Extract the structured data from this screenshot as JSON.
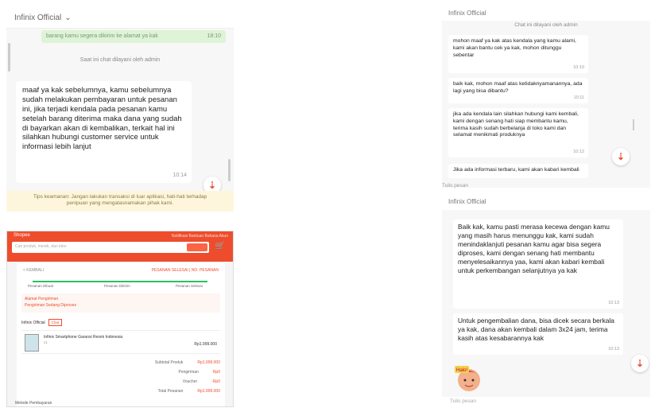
{
  "chat_left": {
    "header_title": "Infinix Official",
    "header_chevron": "⌄",
    "prev_message_snippet": "barang kamu segera dikirim ke alamat ya kak",
    "prev_message_time": "18:10",
    "system_message": "Saat ini chat dilayani oleh admin",
    "message_text": "maaf ya kak sebelumnya, kamu sebelumnya sudah melakukan pembayaran untuk pesanan ini, jika terjadi kendala pada pesanan kamu setelah barang diterima maka dana yang sudah di bayarkan akan di kembalikan, terkait hal ini silahkan hubungi customer service untuk informasi lebih lanjut",
    "message_time": "10:14",
    "warning_text": "Tips keamanan: Jangan lakukan transaksi di luar aplikasi, hati-hati terhadap penipuan yang mengatasnamakan pihak kami.",
    "down_icon": "⇣"
  },
  "order_page": {
    "brand": "Shopee",
    "top_links": "Notifikasi  Bantuan  Bahasa  Akun",
    "search_placeholder": "Cari produk, merek, dan toko",
    "cart_icon": "🛒",
    "back_label": "< KEMBALI",
    "order_status": "PESANAN SELESAI  |  NO. PESANAN",
    "progress_percent": 100,
    "steps": [
      "Pesanan Dibuat",
      "Pesanan Dikirim",
      "Pesanan Selesai"
    ],
    "address_label": "Alamat Pengiriman",
    "address_text": "Pengiriman Sedang Diproses",
    "shop_name": "Infinix Official",
    "chat_button": "Chat",
    "product_name": "Infinix Smartphone Garansi Resmi Indonesia",
    "product_qty": "x1",
    "product_price": "Rp1.999.000",
    "summary": [
      {
        "label": "Subtotal Produk",
        "value": "Rp1.999.000"
      },
      {
        "label": "Pengiriman",
        "value": "Rp0"
      },
      {
        "label": "Voucher",
        "value": "-Rp0"
      },
      {
        "label": "Total Pesanan",
        "value": "Rp1.999.000"
      }
    ],
    "footer_text": "Metode Pembayaran"
  },
  "chat_top_right": {
    "header_title": "Infinix Official",
    "system_message": "Chat ini dilayani oleh admin",
    "messages": [
      {
        "text": "mohon maaf ya kak atas kendala yang kamu alami, kami akan bantu cek ya kak, mohon ditunggu sebentar",
        "time": "10:10"
      },
      {
        "text": "baik kak, mohon maaf atas ketidaknyamanannya, ada lagi yang bisa dibantu?",
        "time": "10:11"
      },
      {
        "text": "jika ada kendala lain silahkan hubungi kami kembali, kami dengan senang hati siap membantu kamu, terima kasih sudah berbelanja di toko kami dan selamat menikmati produknya",
        "time": "10:12"
      },
      {
        "text": "Jika ada informasi terbaru, kami akan kabari kembali",
        "time": ""
      }
    ],
    "down_icon": "⇣"
  },
  "between_label": "Tulis pesan",
  "chat_bottom_right": {
    "header_title": "Infinix Official",
    "messages": [
      {
        "text": "Baik kak, kamu pasti merasa kecewa dengan kamu yang masih harus menunggu kak, kami sudah menindaklanjuti pesanan kamu agar bisa segera diproses, kami dengan senang hati membantu menyelesaikannya yaa, kami akan kabari kembali untuk perkembangan selanjutnya ya kak",
        "time": "10:13"
      },
      {
        "text": "Untuk pengembalian dana, bisa dicek secara berkala ya kak, dana akan kembali dalam 3x24 jam, terima kasih atas kesabarannya kak",
        "time": "10:13"
      }
    ],
    "sticker_label": "Halo!",
    "down_icon": "⇣",
    "input_placeholder": "Tulis pesan"
  }
}
